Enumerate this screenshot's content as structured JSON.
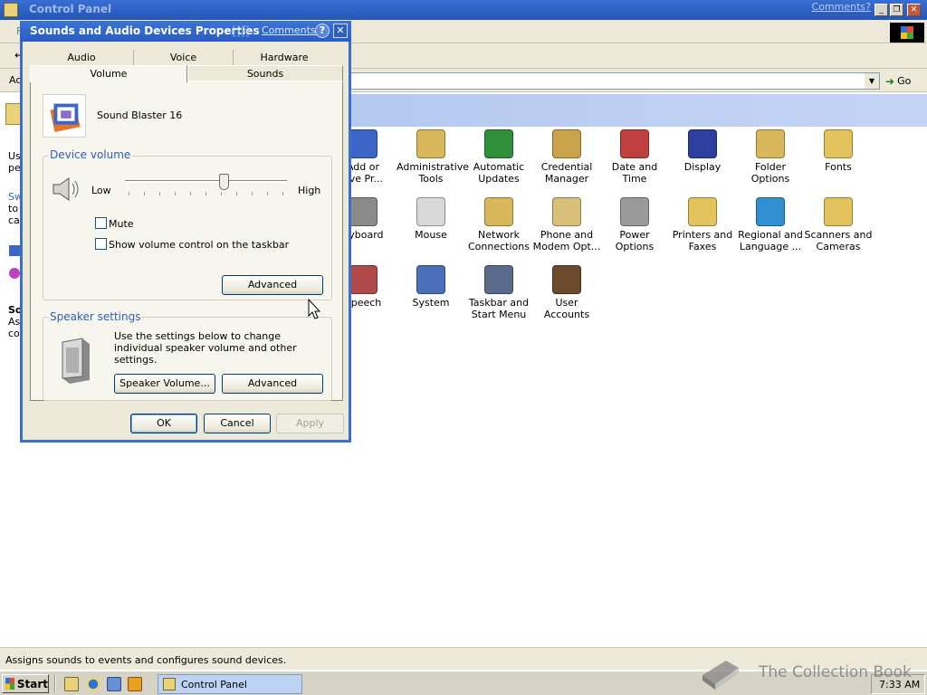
{
  "main_window": {
    "title": "Control Panel",
    "comments_link": "Comments?",
    "menu_fragment": "F",
    "address_fragment": "Ac",
    "go_label": "Go",
    "left_pane_fragments": [
      "Us",
      "pe",
      "Sw",
      "to",
      "ca",
      "So",
      "As",
      "co"
    ],
    "items": [
      {
        "label": "Add or\nove Pr...",
        "icon": "add-remove-programs-icon",
        "color": "#3b66c8"
      },
      {
        "label": "Administrative\nTools",
        "icon": "administrative-tools-icon",
        "color": "#d8b85a"
      },
      {
        "label": "Automatic\nUpdates",
        "icon": "automatic-updates-icon",
        "color": "#2f8f3a"
      },
      {
        "label": "Credential\nManager",
        "icon": "credential-manager-icon",
        "color": "#c9a24a"
      },
      {
        "label": "Date and Time",
        "icon": "date-time-icon",
        "color": "#c04040"
      },
      {
        "label": "Display",
        "icon": "display-icon",
        "color": "#2c3f9f"
      },
      {
        "label": "Folder Options",
        "icon": "folder-options-icon",
        "color": "#d8b85a"
      },
      {
        "label": "Fonts",
        "icon": "fonts-icon",
        "color": "#e3c35c"
      },
      {
        "label": "eyboard",
        "icon": "keyboard-icon",
        "color": "#8a8a8a"
      },
      {
        "label": "Mouse",
        "icon": "mouse-icon",
        "color": "#d9d9d9"
      },
      {
        "label": "Network\nConnections",
        "icon": "network-connections-icon",
        "color": "#d8b85a"
      },
      {
        "label": "Phone and\nModem Opt...",
        "icon": "phone-modem-icon",
        "color": "#d8c07a"
      },
      {
        "label": "Power Options",
        "icon": "power-options-icon",
        "color": "#9a9a9a"
      },
      {
        "label": "Printers and\nFaxes",
        "icon": "printers-faxes-icon",
        "color": "#e3c35c"
      },
      {
        "label": "Regional and\nLanguage ...",
        "icon": "regional-language-icon",
        "color": "#2f8fd0"
      },
      {
        "label": "Scanners and\nCameras",
        "icon": "scanners-cameras-icon",
        "color": "#e3c35c"
      },
      {
        "label": "Speech",
        "icon": "speech-icon",
        "color": "#b04a4a"
      },
      {
        "label": "System",
        "icon": "system-icon",
        "color": "#4a6fb8"
      },
      {
        "label": "Taskbar and\nStart Menu",
        "icon": "taskbar-start-menu-icon",
        "color": "#5a6a8a"
      },
      {
        "label": "User Accounts",
        "icon": "user-accounts-icon",
        "color": "#6a4a2a"
      }
    ],
    "status_text": "Assigns sounds to events and configures sound devices."
  },
  "dialog": {
    "title": "Sounds and Audio Devices Properties",
    "comments_link": "Comments?",
    "help_glyph": "?",
    "close_glyph": "✕",
    "tabs_back": [
      "Audio",
      "Voice",
      "Hardware"
    ],
    "tabs_front": [
      "Volume",
      "Sounds"
    ],
    "active_tab": "Volume",
    "device_name": "Sound Blaster 16",
    "device_volume": {
      "title": "Device volume",
      "low_label": "Low",
      "high_label": "High",
      "level": 0.62,
      "mute_label": "Mute",
      "mute_checked": false,
      "taskbar_label": "Show volume control on the taskbar",
      "taskbar_checked": false,
      "advanced_label": "Advanced"
    },
    "speaker_settings": {
      "title": "Speaker settings",
      "description": "Use the settings below to change individual speaker volume and other settings.",
      "speaker_volume_label": "Speaker Volume...",
      "advanced_label": "Advanced"
    },
    "buttons": {
      "ok": "OK",
      "cancel": "Cancel",
      "apply": "Apply"
    }
  },
  "taskbar": {
    "start_label": "Start",
    "task_label": "Control Panel",
    "clock": "7:33 AM"
  },
  "watermark": "The Collection Book"
}
